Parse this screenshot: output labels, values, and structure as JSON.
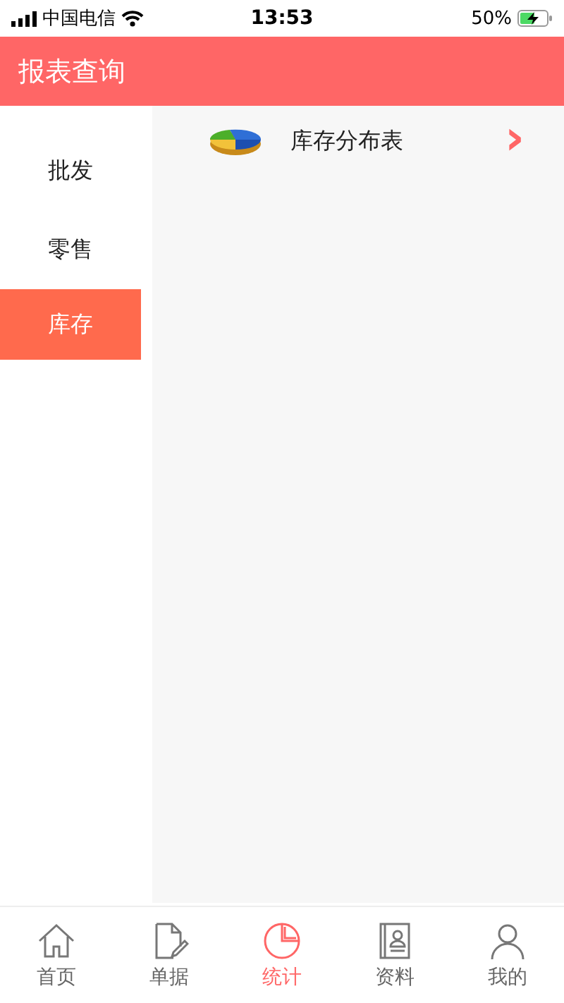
{
  "status_bar": {
    "carrier": "中国电信",
    "time": "13:53",
    "battery": "50%"
  },
  "header": {
    "title": "报表查询"
  },
  "sidebar": {
    "items": [
      {
        "label": "批发",
        "selected": false
      },
      {
        "label": "零售",
        "selected": false
      },
      {
        "label": "库存",
        "selected": true
      }
    ]
  },
  "reports": [
    {
      "label": "库存分布表",
      "arrow": "›"
    }
  ],
  "tab_bar": [
    {
      "label": "首页",
      "kind": "home",
      "selected": false
    },
    {
      "label": "单据",
      "kind": "document",
      "selected": false
    },
    {
      "label": "统计",
      "kind": "pie",
      "selected": true
    },
    {
      "label": "资料",
      "kind": "contacts",
      "selected": false
    },
    {
      "label": "我的",
      "kind": "person",
      "selected": false
    }
  ]
}
